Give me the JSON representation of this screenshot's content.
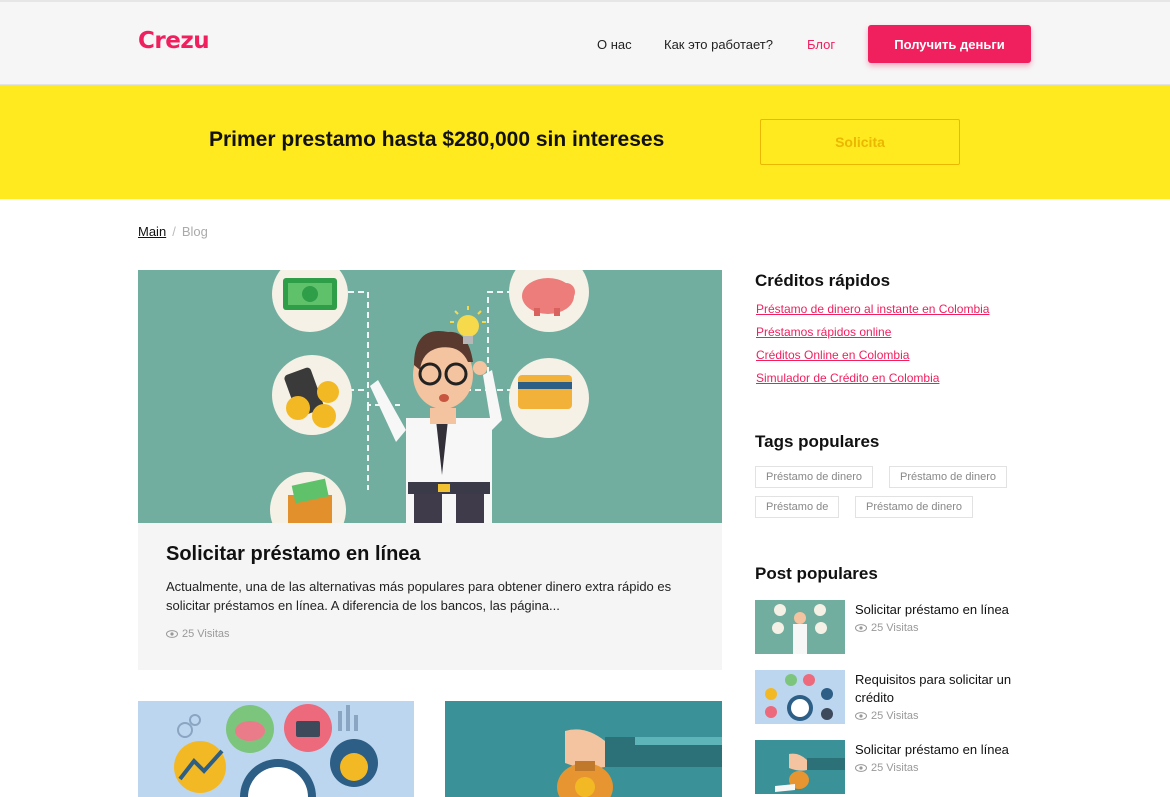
{
  "header": {
    "logo": "Crezu",
    "nav": [
      "О нас",
      "Как это работает?",
      "Блог"
    ],
    "cta": "Получить деньги"
  },
  "promo": {
    "text": "Primer prestamo hasta $280,000 sin intereses",
    "button": "Solicita"
  },
  "breadcrumb": {
    "main": "Main",
    "separator": "/",
    "current": "Blog"
  },
  "featured": {
    "title": "Solicitar préstamo en línea",
    "excerpt": "Actualmente, una de las alternativas más populares para obtener dinero extra rápido es solicitar préstamos en línea. A diferencia de los bancos, las página...",
    "views": "25 Visitas"
  },
  "sidebar": {
    "quick_title": "Créditos rápidos",
    "quick_links": [
      "Préstamo de dinero al instante en Colombia",
      "Préstamos rápidos online",
      "Créditos Online en Colombia",
      "Simulador de Crédito en Colombia"
    ],
    "tags_title": "Tags populares",
    "tags": [
      "Préstamo de dinero",
      "Préstamo de dinero",
      "Préstamo de",
      "Préstamo de dinero"
    ],
    "posts_title": "Post populares",
    "posts": [
      {
        "title": "Solicitar préstamo en línea",
        "views": "25 Visitas"
      },
      {
        "title": "Requisitos para solicitar un crédito",
        "views": "25 Visitas"
      },
      {
        "title": "Solicitar préstamo en línea",
        "views": "25 Visitas"
      }
    ]
  },
  "colors": {
    "brand": "#f0205f",
    "promo": "#ffe91f",
    "promo_accent": "#eab800",
    "illustration_bg": "#72ae9f"
  }
}
